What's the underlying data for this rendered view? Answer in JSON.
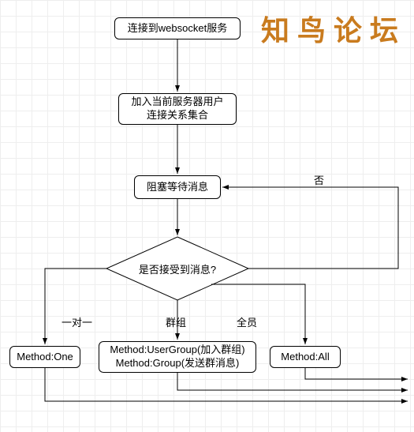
{
  "watermark": "知鸟论坛",
  "nodes": {
    "connect": "连接到websocket服务",
    "join": "加入当前服务器用户\n连接关系集合",
    "wait": "阻塞等待消息",
    "decision": "是否接受到消息?",
    "one": "Method:One",
    "group": "Method:UserGroup(加入群组)\nMethod:Group(发送群消息)",
    "all": "Method:All"
  },
  "edges": {
    "no": "否",
    "one_to_one": "一对一",
    "group_lbl": "群组",
    "all_lbl": "全员"
  }
}
